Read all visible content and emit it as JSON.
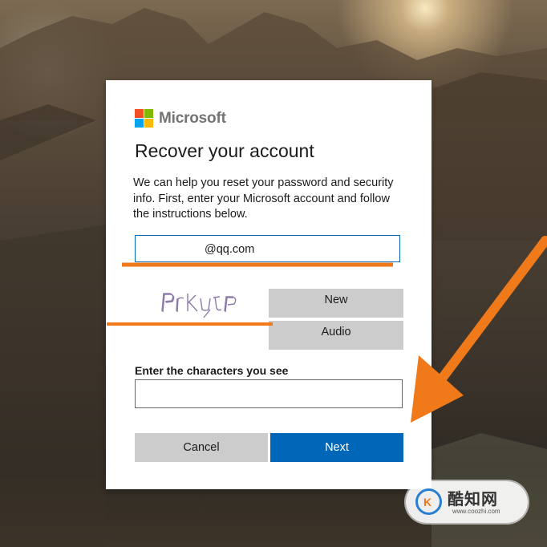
{
  "brand": {
    "name": "Microsoft",
    "logo_colors": [
      "#f25022",
      "#7fba00",
      "#00a4ef",
      "#ffb900"
    ]
  },
  "page": {
    "title": "Recover your account",
    "description": "We can help you reset your password and security info. First, enter your Microsoft account and follow the instructions below."
  },
  "form": {
    "email_value": "@qq.com",
    "captcha": {
      "new_label": "New",
      "audio_label": "Audio"
    },
    "chars_label": "Enter the characters you see",
    "chars_value": "",
    "cancel_label": "Cancel",
    "next_label": "Next"
  },
  "colors": {
    "primary_button": "#0067b8",
    "secondary_button": "#cccccc",
    "annotation": "#f07a1a"
  },
  "watermark": {
    "title": "酷知网",
    "url": "www.coozhi.com"
  }
}
